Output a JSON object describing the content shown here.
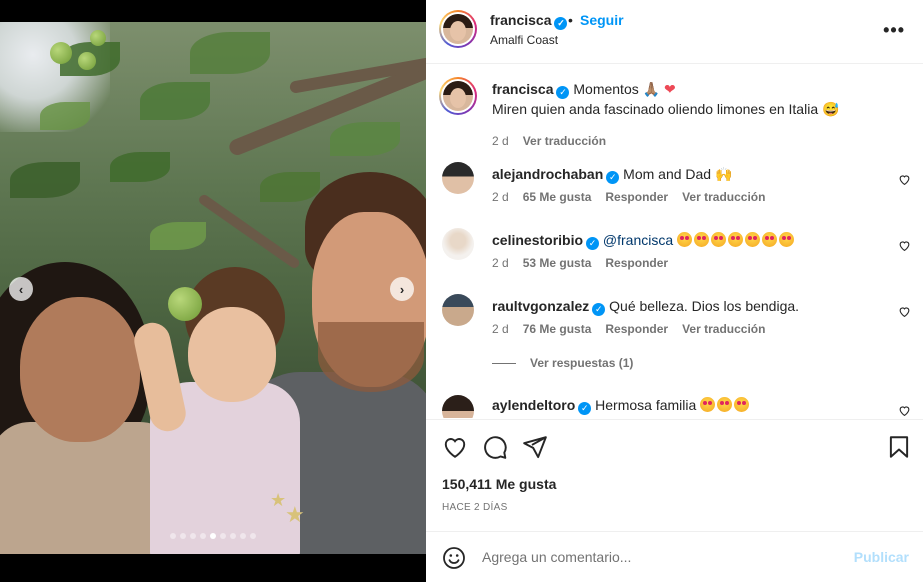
{
  "post": {
    "username": "francisca",
    "follow_label": "Seguir",
    "separator": "•",
    "location": "Amalfi Coast",
    "more_icon": "more-horizontal-icon",
    "carousel": {
      "total_slides": 9,
      "active_slide": 5
    }
  },
  "caption": {
    "username": "francisca",
    "line1": "Momentos 🙏🏽",
    "heart": "❤",
    "line2": "Miren quien anda fascinado oliendo limones en Italia 😅",
    "time": "2 d",
    "translate": "Ver traducción"
  },
  "comments": [
    {
      "username": "alejandrochaban",
      "text": "Mom and Dad 🙌",
      "time": "2 d",
      "likes": "65 Me gusta",
      "reply": "Responder",
      "translate": "Ver traducción"
    },
    {
      "username": "celinestoribio",
      "mention": "@francisca",
      "emoji_count": 7,
      "time": "2 d",
      "likes": "53 Me gusta",
      "reply": "Responder"
    },
    {
      "username": "raultvgonzalez",
      "text": "Qué belleza. Dios los bendiga.",
      "time": "2 d",
      "likes": "76 Me gusta",
      "reply": "Responder",
      "translate": "Ver traducción",
      "view_replies": "Ver respuestas (1)"
    },
    {
      "username": "aylendeltoro",
      "text": "Hermosa familia",
      "emoji_count": 3
    }
  ],
  "actions": {
    "likes": "150,411 Me gusta",
    "date": "HACE 2 DÍAS"
  },
  "add_comment": {
    "placeholder": "Agrega un comentario...",
    "post_label": "Publicar"
  },
  "colors": {
    "accent": "#0095f6",
    "muted": "#737373",
    "post_disabled": "#b2dffc"
  }
}
